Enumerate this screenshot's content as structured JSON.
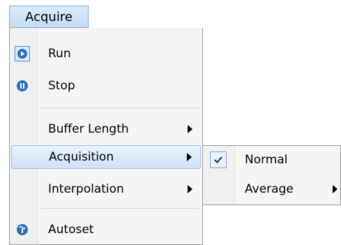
{
  "menubar": {
    "acquire_label": "Acquire"
  },
  "menu": {
    "items": [
      {
        "label": "Run",
        "icon": "run-icon"
      },
      {
        "label": "Stop",
        "icon": "stop-icon"
      },
      {
        "label": "Buffer Length",
        "has_submenu": true
      },
      {
        "label": "Acquisition",
        "has_submenu": true,
        "highlighted": true
      },
      {
        "label": "Interpolation",
        "has_submenu": true
      },
      {
        "label": "Autoset",
        "icon": "autoset-icon"
      }
    ]
  },
  "submenu": {
    "items": [
      {
        "label": "Normal",
        "checked": true
      },
      {
        "label": "Average",
        "has_submenu": true
      }
    ]
  },
  "colors": {
    "highlight": "#cde2f9",
    "icon_blue": "#2a6fb8",
    "menu_bg": "#f5f5f5"
  }
}
